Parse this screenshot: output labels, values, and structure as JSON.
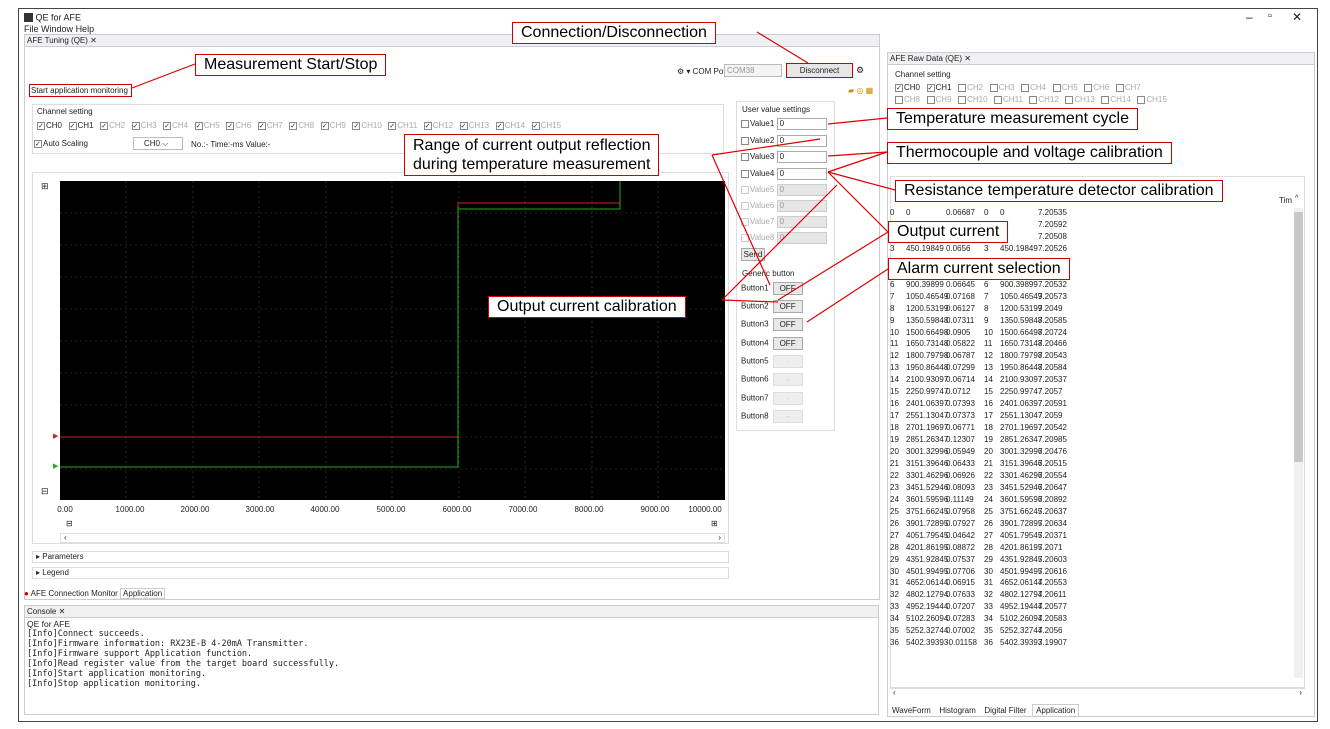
{
  "app": {
    "title": "QE for AFE",
    "menu": [
      "File",
      "Window",
      "Help"
    ]
  },
  "tuning": {
    "tab_label": "AFE Tuning (QE)",
    "com_label": "▾ COM Port:",
    "com_value": "COM38",
    "disconnect_label": "Disconnect",
    "start_monitor_label": "Start application monitoring",
    "channel_setting_label": "Channel setting",
    "channels": [
      "CH0",
      "CH1",
      "CH2",
      "CH3",
      "CH4",
      "CH5",
      "CH6",
      "CH7",
      "CH8",
      "CH9",
      "CH10",
      "CH11",
      "CH12",
      "CH13",
      "CH14",
      "CH15"
    ],
    "auto_scaling_label": "Auto Scaling",
    "channel_select": "CH0",
    "info_text": "No.:- Time:-ms Value:-",
    "x_ticks": [
      "0.00",
      "1000.00",
      "2000.00",
      "3000.00",
      "4000.00",
      "5000.00",
      "6000.00",
      "7000.00",
      "8000.00",
      "9000.00",
      "10000.00"
    ],
    "parameters_label": "Parameters",
    "legend_label": "Legend"
  },
  "user_values": {
    "title": "User value settings",
    "items": [
      {
        "label": "Value1",
        "value": "0"
      },
      {
        "label": "Value2",
        "value": "0"
      },
      {
        "label": "Value3",
        "value": "0"
      },
      {
        "label": "Value4",
        "value": "0"
      },
      {
        "label": "Value5",
        "value": "0"
      },
      {
        "label": "Value6",
        "value": "0"
      },
      {
        "label": "Value7",
        "value": "0"
      },
      {
        "label": "Value8",
        "value": "0"
      }
    ],
    "send_label": "Send"
  },
  "generic_buttons": {
    "title": "Generic button",
    "items": [
      {
        "label": "Button1",
        "state": "OFF"
      },
      {
        "label": "Button2",
        "state": "OFF"
      },
      {
        "label": "Button3",
        "state": "OFF"
      },
      {
        "label": "Button4",
        "state": "OFF"
      },
      {
        "label": "Button5",
        "state": "-"
      },
      {
        "label": "Button6",
        "state": "-"
      },
      {
        "label": "Button7",
        "state": "-"
      },
      {
        "label": "Button8",
        "state": "-"
      }
    ]
  },
  "bottom_tabs": [
    "AFE Connection",
    "Monitor",
    "Application"
  ],
  "console": {
    "tab_label": "Console",
    "header": "QE for AFE",
    "lines": [
      "[Info]Connect succeeds.",
      "[Info]Firmware information: RX23E-B 4-20mA Transmitter.",
      "[Info]Firmware support Application function.",
      "[Info]Read register value from the target board successfully.",
      "[Info]Start application monitoring.",
      "[Info]Stop application monitoring."
    ]
  },
  "raw": {
    "tab_label": "AFE Raw Data (QE)",
    "channel_setting_label": "Channel setting",
    "channels_row1": [
      "CH0",
      "CH1",
      "CH2",
      "CH3",
      "CH4",
      "CH5",
      "CH6",
      "CH7"
    ],
    "channels_row2": [
      "CH8",
      "CH9",
      "CH10",
      "CH11",
      "CH12",
      "CH13",
      "CH14",
      "CH15"
    ],
    "time_header": "Tim",
    "rows": [
      [
        "0",
        "0",
        "0.06687",
        "0",
        "0",
        "7.20535"
      ],
      [
        "",
        "",
        "",
        "",
        "",
        "7.20592"
      ],
      [
        "",
        "",
        "",
        "",
        "",
        "7.20508"
      ],
      [
        "3",
        "450.19849",
        "0.0656",
        "3",
        "450.19849",
        "7.20526"
      ],
      [
        "",
        "",
        "",
        "",
        "",
        ""
      ],
      [
        "",
        "",
        "",
        "",
        "",
        ""
      ],
      [
        "6",
        "900.39899",
        "0.06645",
        "6",
        "900.39899",
        "7.20532"
      ],
      [
        "7",
        "1050.46549",
        "0.07168",
        "7",
        "1050.46549",
        "7.20573"
      ],
      [
        "8",
        "1200.53199",
        "0.06127",
        "8",
        "1200.53199",
        "7.2049"
      ],
      [
        "9",
        "1350.59848",
        "0.07311",
        "9",
        "1350.59848",
        "7.20585"
      ],
      [
        "10",
        "1500.66498",
        "0.0905",
        "10",
        "1500.66498",
        "7.20724"
      ],
      [
        "11",
        "1650.73148",
        "0.05822",
        "11",
        "1650.73148",
        "7.20466"
      ],
      [
        "12",
        "1800.79798",
        "0.06787",
        "12",
        "1800.79798",
        "7.20543"
      ],
      [
        "13",
        "1950.86448",
        "0.07299",
        "13",
        "1950.86448",
        "7.20584"
      ],
      [
        "14",
        "2100.93097",
        "0.06714",
        "14",
        "2100.93097",
        "7.20537"
      ],
      [
        "15",
        "2250.99747",
        "0.0712",
        "15",
        "2250.99747",
        "7.2057"
      ],
      [
        "16",
        "2401.06397",
        "0.07393",
        "16",
        "2401.06397",
        "7.20591"
      ],
      [
        "17",
        "2551.13047",
        "0.07373",
        "17",
        "2551.13047",
        "7.2059"
      ],
      [
        "18",
        "2701.19697",
        "0.06771",
        "18",
        "2701.19697",
        "7.20542"
      ],
      [
        "19",
        "2851.26347",
        "0.12307",
        "19",
        "2851.26347",
        "7.20985"
      ],
      [
        "20",
        "3001.32996",
        "0.05949",
        "20",
        "3001.32996",
        "7.20476"
      ],
      [
        "21",
        "3151.39646",
        "0.06433",
        "21",
        "3151.39646",
        "7.20515"
      ],
      [
        "22",
        "3301.46296",
        "0.06926",
        "22",
        "3301.46296",
        "7.20554"
      ],
      [
        "23",
        "3451.52946",
        "0.08093",
        "23",
        "3451.52946",
        "7.20647"
      ],
      [
        "24",
        "3601.59596",
        "0.11149",
        "24",
        "3601.59596",
        "7.20892"
      ],
      [
        "25",
        "3751.66245",
        "0.07958",
        "25",
        "3751.66245",
        "7.20637"
      ],
      [
        "26",
        "3901.72895",
        "0.07927",
        "26",
        "3901.72895",
        "7.20634"
      ],
      [
        "27",
        "4051.79545",
        "0.04642",
        "27",
        "4051.79545",
        "7.20371"
      ],
      [
        "28",
        "4201.86195",
        "0.08872",
        "28",
        "4201.86195",
        "7.2071"
      ],
      [
        "29",
        "4351.92845",
        "0.07537",
        "29",
        "4351.92845",
        "7.20603"
      ],
      [
        "30",
        "4501.99495",
        "0.07706",
        "30",
        "4501.99495",
        "7.20616"
      ],
      [
        "31",
        "4652.06144",
        "0.06915",
        "31",
        "4652.06144",
        "7.20553"
      ],
      [
        "32",
        "4802.12794",
        "0.07633",
        "32",
        "4802.12794",
        "7.20611"
      ],
      [
        "33",
        "4952.19444",
        "0.07207",
        "33",
        "4952.19444",
        "7.20577"
      ],
      [
        "34",
        "5102.26094",
        "0.07283",
        "34",
        "5102.26094",
        "7.20583"
      ],
      [
        "35",
        "5252.32744",
        "0.07002",
        "35",
        "5252.32744",
        "7.2056"
      ],
      [
        "36",
        "5402.39393",
        "-0.01158",
        "36",
        "5402.39393",
        "7.19907"
      ]
    ],
    "tabs": [
      "WaveForm",
      "Histogram",
      "Digital Filter",
      "Application"
    ]
  },
  "callouts": {
    "connection": "Connection/Disconnection",
    "measurement": "Measurement Start/Stop",
    "temp_cycle": "Temperature measurement cycle",
    "range_line1": "Range of current output reflection",
    "range_line2": "during temperature measurement",
    "thermocouple": "Thermocouple and voltage calibration",
    "rtd": "Resistance temperature detector calibration",
    "output_current": "Output current",
    "alarm": "Alarm current selection",
    "output_cal": "Output current calibration"
  },
  "colors": {
    "callout_border": "#cc0000",
    "plot_bg": "#000000",
    "trace_red": "#cc2222",
    "trace_green": "#22aa22"
  }
}
